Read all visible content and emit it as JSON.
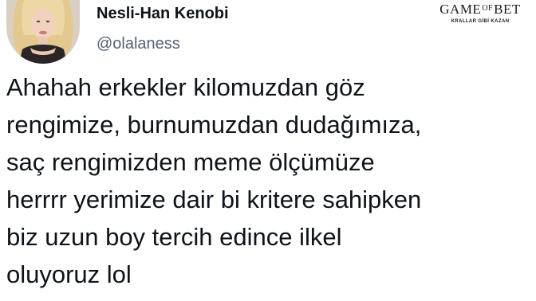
{
  "author": {
    "display_name": "Nesli-Han Kenobi",
    "handle": "@olalaness"
  },
  "tweet": {
    "lines": [
      "Ahahah erkekler kilomuzdan göz",
      "rengimize, burnumuzdan dudağımıza,",
      "saç rengimizden meme ölçümüze",
      "herrrr yerimize dair bi kritere sahipken",
      "biz uzun boy tercih edince ilkel",
      "oluyoruz lol"
    ]
  },
  "watermark": {
    "word_1": "GAME",
    "word_2": "OF",
    "word_3": "BET",
    "tagline": "KRALLAR GİBİ KAZAN"
  },
  "colors": {
    "text_primary": "#0f1419",
    "text_secondary": "#536471",
    "background": "#ffffff"
  }
}
